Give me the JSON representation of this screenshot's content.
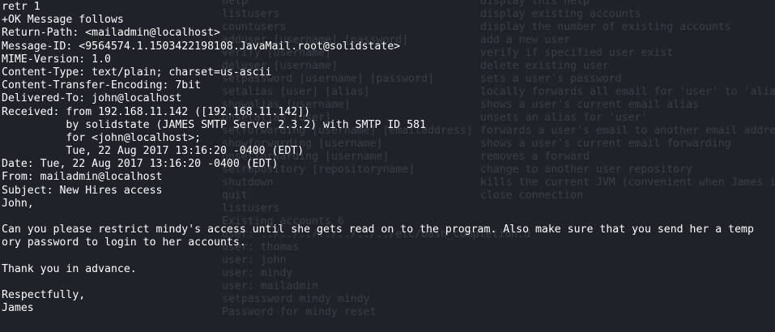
{
  "ghost_col1": [
    "help",
    "listusers",
    "countusers",
    "adduser [username] [password]",
    "verify [username]",
    "deluser [username]",
    "setpassword [username] [password]",
    "setalias [user] [alias]",
    "showalias [username]",
    "unsetalias [user]",
    "setforwarding [username] [emailaddress]",
    "showforwarding [username]",
    "unsetforwarding [username]",
    "setrepository [repositoryname]",
    "shutdown",
    "quit",
    "listusers",
    "Existing accounts 6",
    "user: ../../../../../../../etc/bash_completion.d",
    "user: thomas",
    "user: john",
    "user: mindy",
    "user: mailadmin",
    "setpassword mindy mindy",
    "Password for mindy reset"
  ],
  "ghost_col2": [
    "display this help",
    "display existing accounts",
    "display the number of existing accounts",
    "add a new user",
    "verify if specified user exist",
    "delete existing user",
    "sets a user's password",
    "locally forwards all email for 'user' to 'alias'",
    "shows a user's current email alias",
    "unsets an alias for 'user'",
    "forwards a user's email to another email address",
    "shows a user's current email forwarding",
    "removes a forward",
    "change to another user repository",
    "kills the current JVM (convenient when James is run as a daemon)",
    "close connection"
  ],
  "lines": [
    "retr 1",
    "+OK Message follows",
    "Return-Path: <mailadmin@localhost>",
    "Message-ID: <9564574.1.1503422198108.JavaMail.root@solidstate>",
    "MIME-Version: 1.0",
    "Content-Type: text/plain; charset=us-ascii",
    "Content-Transfer-Encoding: 7bit",
    "Delivered-To: john@localhost",
    "Received: from 192.168.11.142 ([192.168.11.142])",
    "          by solidstate (JAMES SMTP Server 2.3.2) with SMTP ID 581",
    "          for <john@localhost>;",
    "          Tue, 22 Aug 2017 13:16:20 -0400 (EDT)",
    "Date: Tue, 22 Aug 2017 13:16:20 -0400 (EDT)",
    "From: mailadmin@localhost",
    "Subject: New Hires access",
    "John,",
    "",
    "Can you please restrict mindy's access until she gets read on to the program. Also make sure that you send her a temp",
    "ory password to login to her accounts.",
    "",
    "Thank you in advance.",
    "",
    "Respectfully,",
    "James"
  ]
}
